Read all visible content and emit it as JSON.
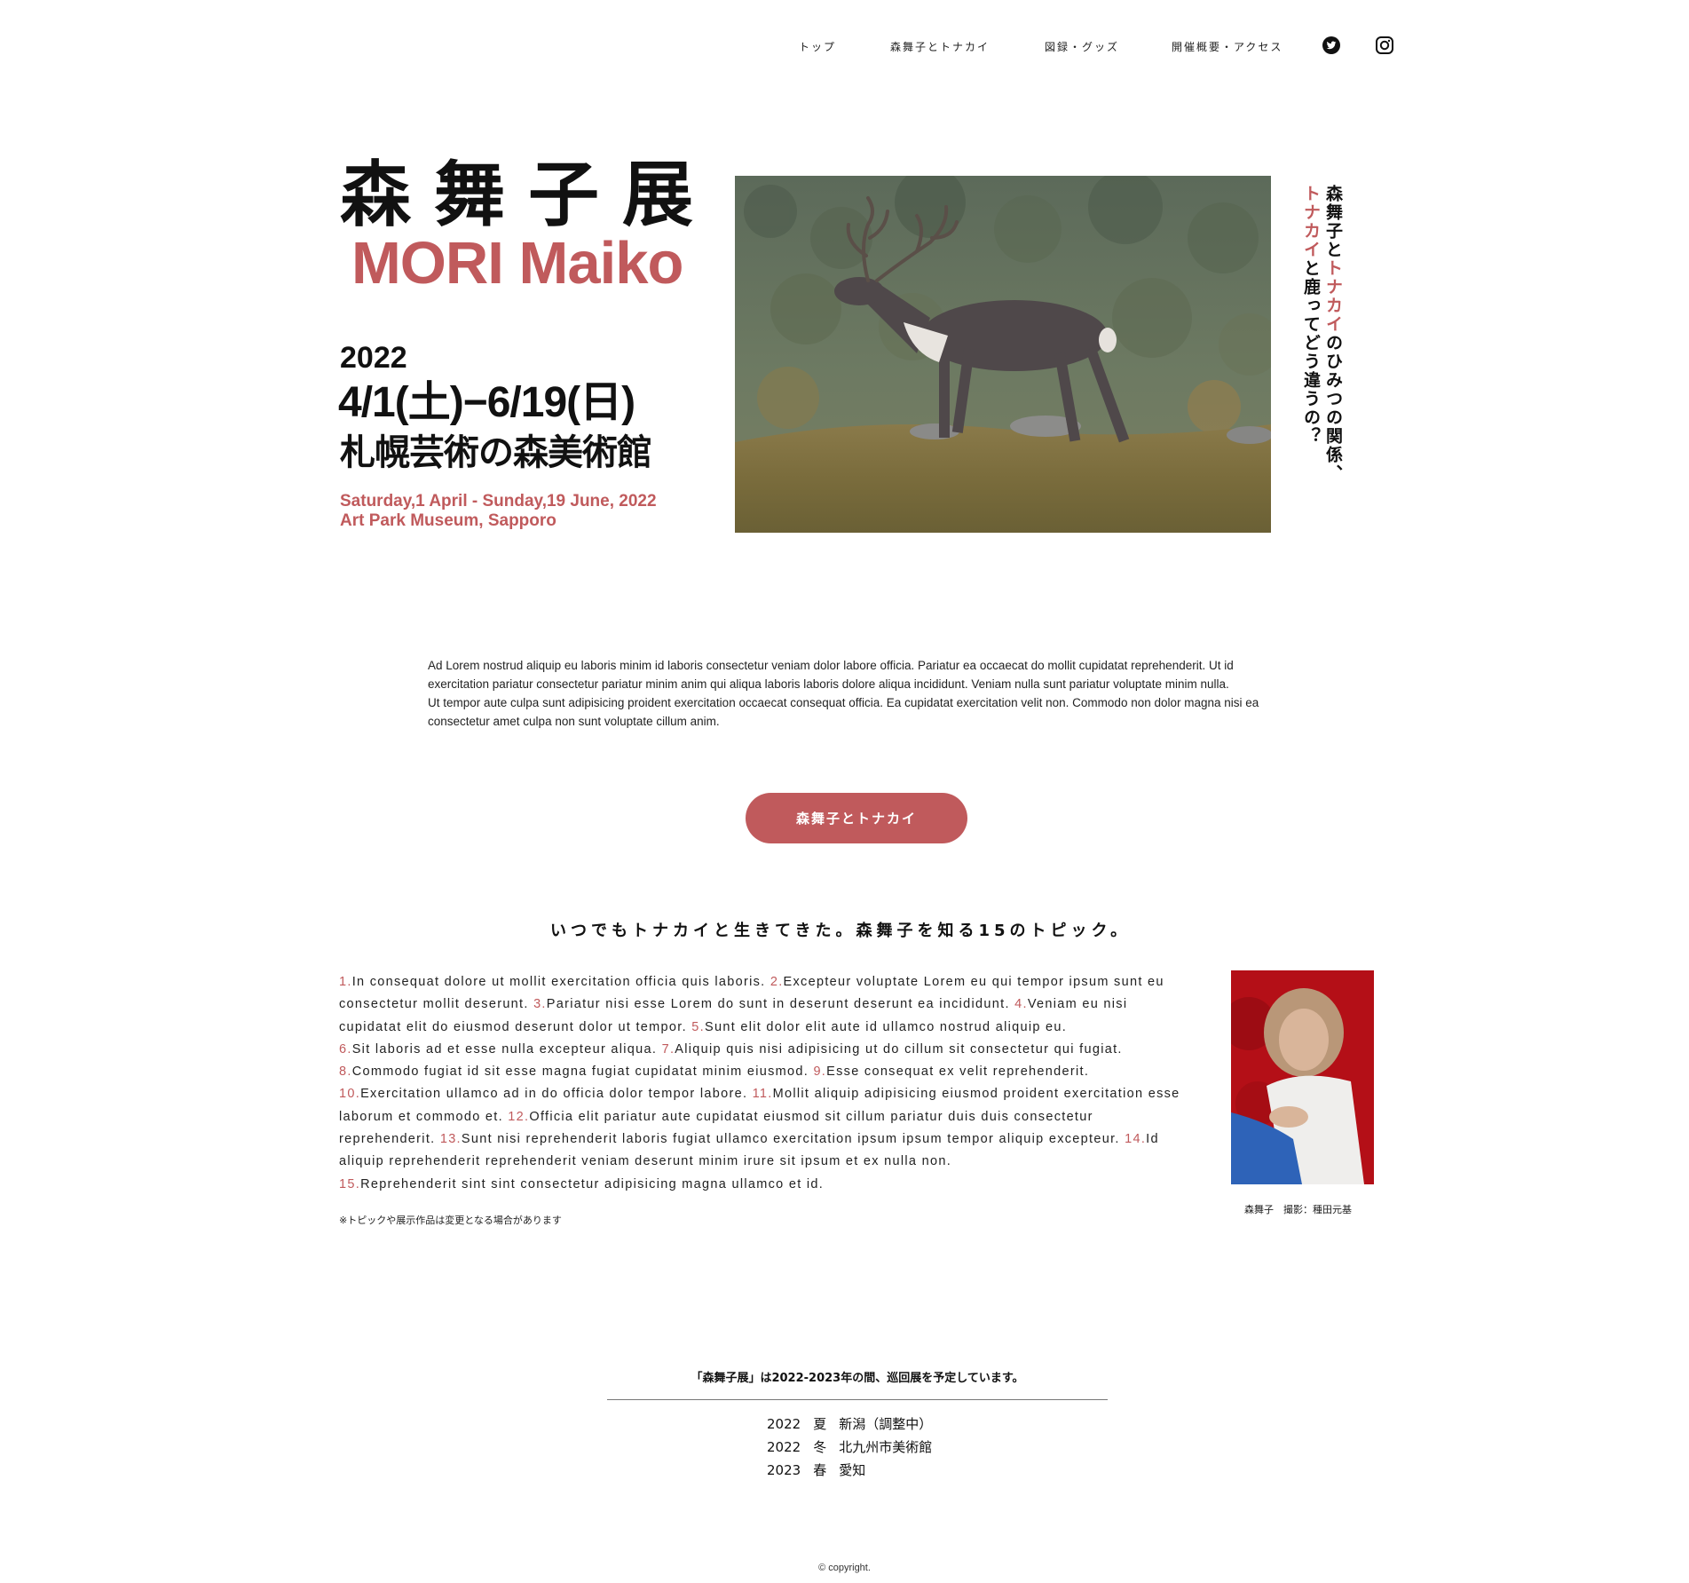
{
  "nav": {
    "items": [
      "トップ",
      "森舞子とトナカイ",
      "図録・グッズ",
      "開催概要・アクセス"
    ],
    "icons": [
      "twitter-icon",
      "instagram-icon"
    ]
  },
  "hero": {
    "title_jp": "森舞子展",
    "title_en": "MORI Maiko",
    "year": "2022",
    "dates": "4/1(土)−6/19(日)",
    "venue": "札幌芸術の森美術館",
    "dates_en": "Saturday,1 April - Sunday,19 June, 2022",
    "venue_en": "Art Park Museum, Sapporo",
    "vertical_copy": {
      "line1_a": "森舞子と",
      "line1_b": "トナカイ",
      "line1_c": "のひみつの関係、",
      "line2_a": "トナカイ",
      "line2_b": "と鹿ってどう違うの？"
    }
  },
  "intro": {
    "paragraphs": [
      "Ad Lorem nostrud aliquip eu laboris minim id laboris consectetur veniam dolor labore officia. Pariatur ea occaecat do mollit cupidatat reprehenderit. Ut id exercitation pariatur consectetur pariatur minim anim qui aliqua laboris laboris dolore aliqua incididunt. Veniam nulla sunt pariatur voluptate minim nulla.",
      "Ut tempor aute culpa sunt adipisicing proident exercitation occaecat consequat officia. Ea cupidatat exercitation velit non. Commodo non dolor magna nisi ea consectetur amet culpa non sunt voluptate cillum anim."
    ]
  },
  "cta": {
    "label": "森舞子とトナカイ"
  },
  "topics": {
    "heading": "いつでもトナカイと生きてきた。森舞子を知る15のトピック。",
    "items": [
      {
        "num": "1.",
        "text": "In consequat dolore ut mollit exercitation officia quis laboris."
      },
      {
        "num": "2.",
        "text": "Excepteur voluptate Lorem eu qui tempor ipsum sunt eu consectetur mollit deserunt."
      },
      {
        "num": "3.",
        "text": "Pariatur nisi esse Lorem do sunt in deserunt deserunt ea incididunt."
      },
      {
        "num": "4.",
        "text": "Veniam eu nisi cupidatat elit do eiusmod deserunt dolor ut tempor."
      },
      {
        "num": "5.",
        "text": "Sunt elit dolor elit aute id ullamco nostrud aliquip eu."
      },
      {
        "num": "6.",
        "text": "Sit laboris ad et esse nulla excepteur aliqua."
      },
      {
        "num": "7.",
        "text": "Aliquip quis nisi adipisicing ut do cillum sit consectetur qui fugiat."
      },
      {
        "num": "8.",
        "text": "Commodo fugiat id sit esse magna fugiat cupidatat minim eiusmod."
      },
      {
        "num": "9.",
        "text": "Esse consequat ex velit reprehenderit."
      },
      {
        "num": "10.",
        "text": "Exercitation ullamco ad in do officia dolor tempor labore."
      },
      {
        "num": "11.",
        "text": "Mollit aliquip adipisicing eiusmod proident exercitation esse laborum et commodo et."
      },
      {
        "num": "12.",
        "text": "Officia elit pariatur aute cupidatat eiusmod sit cillum pariatur duis duis consectetur reprehenderit."
      },
      {
        "num": "13.",
        "text": "Sunt nisi reprehenderit laboris fugiat ullamco exercitation ipsum ipsum tempor aliquip excepteur."
      },
      {
        "num": "14.",
        "text": "Id aliquip reprehenderit reprehenderit veniam deserunt minim irure sit ipsum et ex nulla non."
      },
      {
        "num": "15.",
        "text": "Reprehenderit sint sint consectetur adipisicing magna ullamco et id."
      }
    ],
    "note": "※トピックや展示作品は変更となる場合があります",
    "portrait_caption": "森舞子　撮影：種田元基"
  },
  "tour": {
    "heading": "「森舞子展」は2022-2023年の間、巡回展を予定しています。",
    "rows": [
      {
        "year": "2022",
        "season": "夏",
        "place": "新潟（調整中）"
      },
      {
        "year": "2022",
        "season": "冬",
        "place": "北九州市美術館"
      },
      {
        "year": "2023",
        "season": "春",
        "place": "愛知"
      }
    ]
  },
  "footer": {
    "copyright": "© copyright."
  },
  "colors": {
    "accent": "#c05a5c",
    "text": "#111111",
    "background": "#ffffff"
  }
}
